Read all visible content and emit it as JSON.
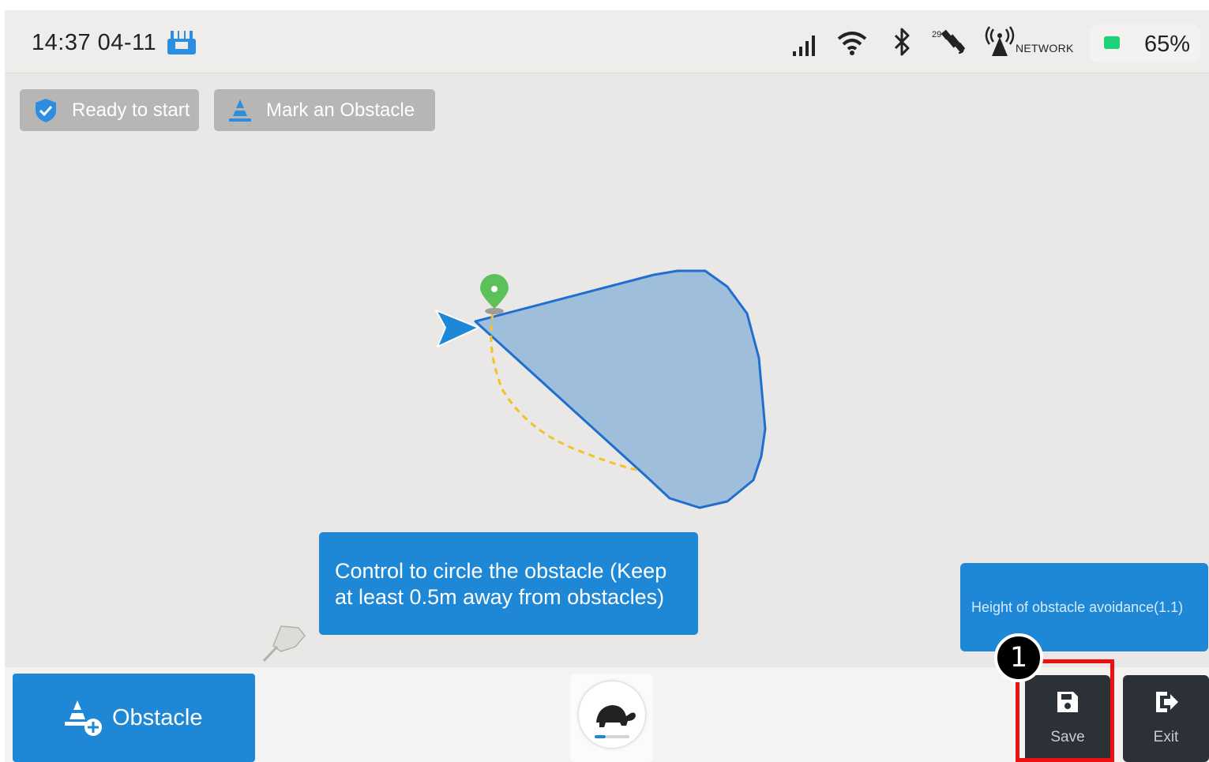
{
  "status_bar": {
    "time": "14:37 04-11",
    "satellite_count": "29",
    "network_label": "NETWORK",
    "battery": "65%",
    "battery_color": "#1fd07a",
    "icons": [
      "remote-controller-icon",
      "cellular-signal-icon",
      "wifi-icon",
      "bluetooth-icon",
      "satellite-icon",
      "network-tower-icon",
      "battery-icon"
    ]
  },
  "top_chips": {
    "ready_label": "Ready to start",
    "mark_label": "Mark an Obstacle"
  },
  "map": {
    "hint_text": "Control to circle the obstacle (Keep at least 0.5m away from obstacles)",
    "height_label": "Height of obstacle avoidance(1.1)",
    "polygon_fill": "#9fbedb",
    "polygon_stroke": "#1e6fcf",
    "path_color": "#f2c326",
    "marker_color": "#5cc15b",
    "arrow_color": "#1e88d6"
  },
  "bottom_bar": {
    "obstacle_label": "Obstacle",
    "save_label": "Save",
    "exit_label": "Exit",
    "speed_icon": "turtle-icon"
  },
  "annotation": {
    "step_number": "1",
    "highlight_color": "#ee1111"
  },
  "colors": {
    "accent": "#1e88d6",
    "dark_button": "#2b3137"
  }
}
